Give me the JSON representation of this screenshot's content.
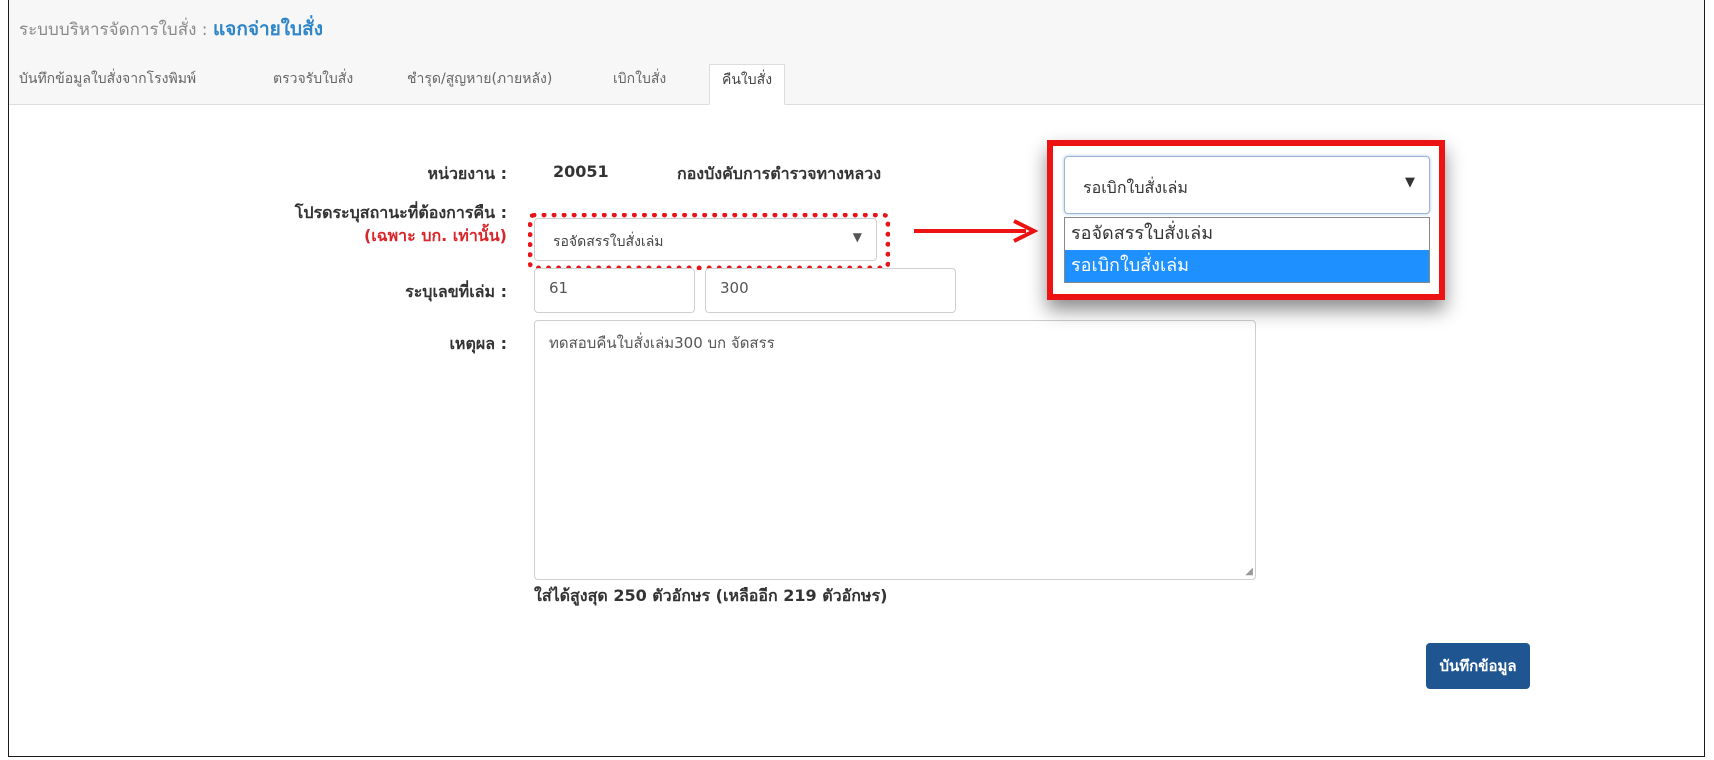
{
  "header": {
    "system_name": "ระบบบริหารจัดการใบสั่ง :",
    "current_module": "แจกจ่ายใบสั่ง"
  },
  "tabs": [
    {
      "label": "บันทึกข้อมูลใบสั่งจากโรงพิมพ์",
      "active": false
    },
    {
      "label": "ตรวจรับใบสั่ง",
      "active": false
    },
    {
      "label": "ชำรุด/สูญหาย(ภายหลัง)",
      "active": false
    },
    {
      "label": "เบิกใบสั่ง",
      "active": false
    },
    {
      "label": "คืนใบสั่ง",
      "active": true
    }
  ],
  "form": {
    "unit_label": "หน่วยงาน :",
    "unit_code": "20051",
    "unit_name": "กองบังคับการตำรวจทางหลวง",
    "location_label": "โปรดระบุสถานะที่ต้องการคืน :",
    "location_note": "(เฉพาะ บก. เท่านั้น)",
    "location_selected": "รอจัดสรรใบสั่งเล่ม",
    "book_label": "ระบุเลขที่เล่ม :",
    "book_from": "61",
    "book_to": "300",
    "reason_label": "เหตุผล :",
    "reason_value": "ทดสอบคืนใบสั่งเล่ม300 บก จัดสรร",
    "char_hint": "ใส่ได้สูงสุด 250 ตัวอักษร (เหลืออีก 219 ตัวอักษร)"
  },
  "callout": {
    "selected": "รอเบิกใบสั่งเล่ม",
    "options": [
      "รอจัดสรรใบสั่งเล่ม",
      "รอเบิกใบสั่งเล่ม"
    ],
    "highlighted_index": 1,
    "highlight_color": "#1e90ff"
  },
  "actions": {
    "save_label": "บันทึกข้อมูล"
  },
  "colors": {
    "annotation_red": "#ee1313",
    "breadcrumb_active": "#2f86c8",
    "primary_button": "#1f5591",
    "required_note": "#d9262a"
  }
}
